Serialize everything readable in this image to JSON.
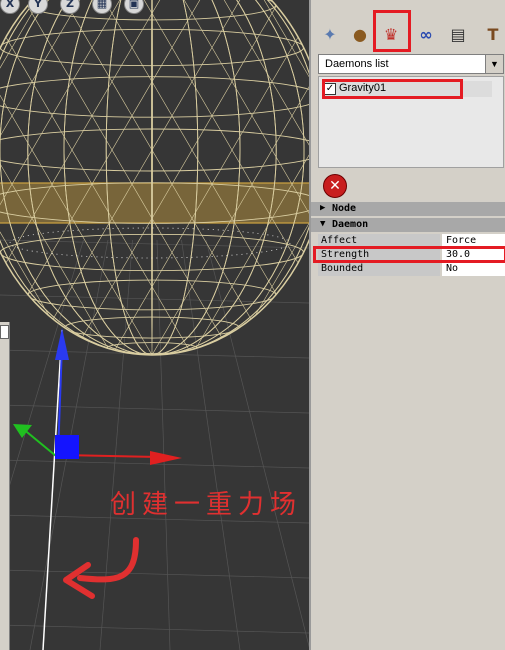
{
  "viewport": {
    "toolbar": [
      {
        "name": "x-icon",
        "glyph": "X"
      },
      {
        "name": "y-icon",
        "glyph": "Y"
      },
      {
        "name": "z-icon",
        "glyph": "Z"
      },
      {
        "name": "grid-icon",
        "glyph": "▦"
      },
      {
        "name": "save-icon",
        "glyph": "▣"
      }
    ],
    "caption": "创建一重力场",
    "colors": {
      "wire": "#d9cda0",
      "band": "#c9a040",
      "x_axis": "#e02020",
      "y_axis": "#2a3af0",
      "z_axis": "#20c020",
      "annotation": "#e03030"
    }
  },
  "panel": {
    "tabs": [
      {
        "name": "particle-tab-icon",
        "glyph": "✦"
      },
      {
        "name": "material-tab-icon",
        "glyph": "●"
      },
      {
        "name": "daemon-tab-icon",
        "glyph": "♛"
      },
      {
        "name": "link-tab-icon",
        "glyph": "∞"
      },
      {
        "name": "render-tab-icon",
        "glyph": "▤"
      },
      {
        "name": "tools-tab-icon",
        "glyph": "T"
      }
    ],
    "dropdown": {
      "value": "Daemons list"
    },
    "list": {
      "item_label": "Gravity01",
      "checked": true
    },
    "sections": {
      "node": "Node",
      "daemon": "Daemon"
    },
    "properties": [
      {
        "name": "Affect",
        "value": "Force"
      },
      {
        "name": "Strength",
        "value": "30.0"
      },
      {
        "name": "Bounded",
        "value": "No"
      }
    ],
    "accent": "#e41b23"
  }
}
